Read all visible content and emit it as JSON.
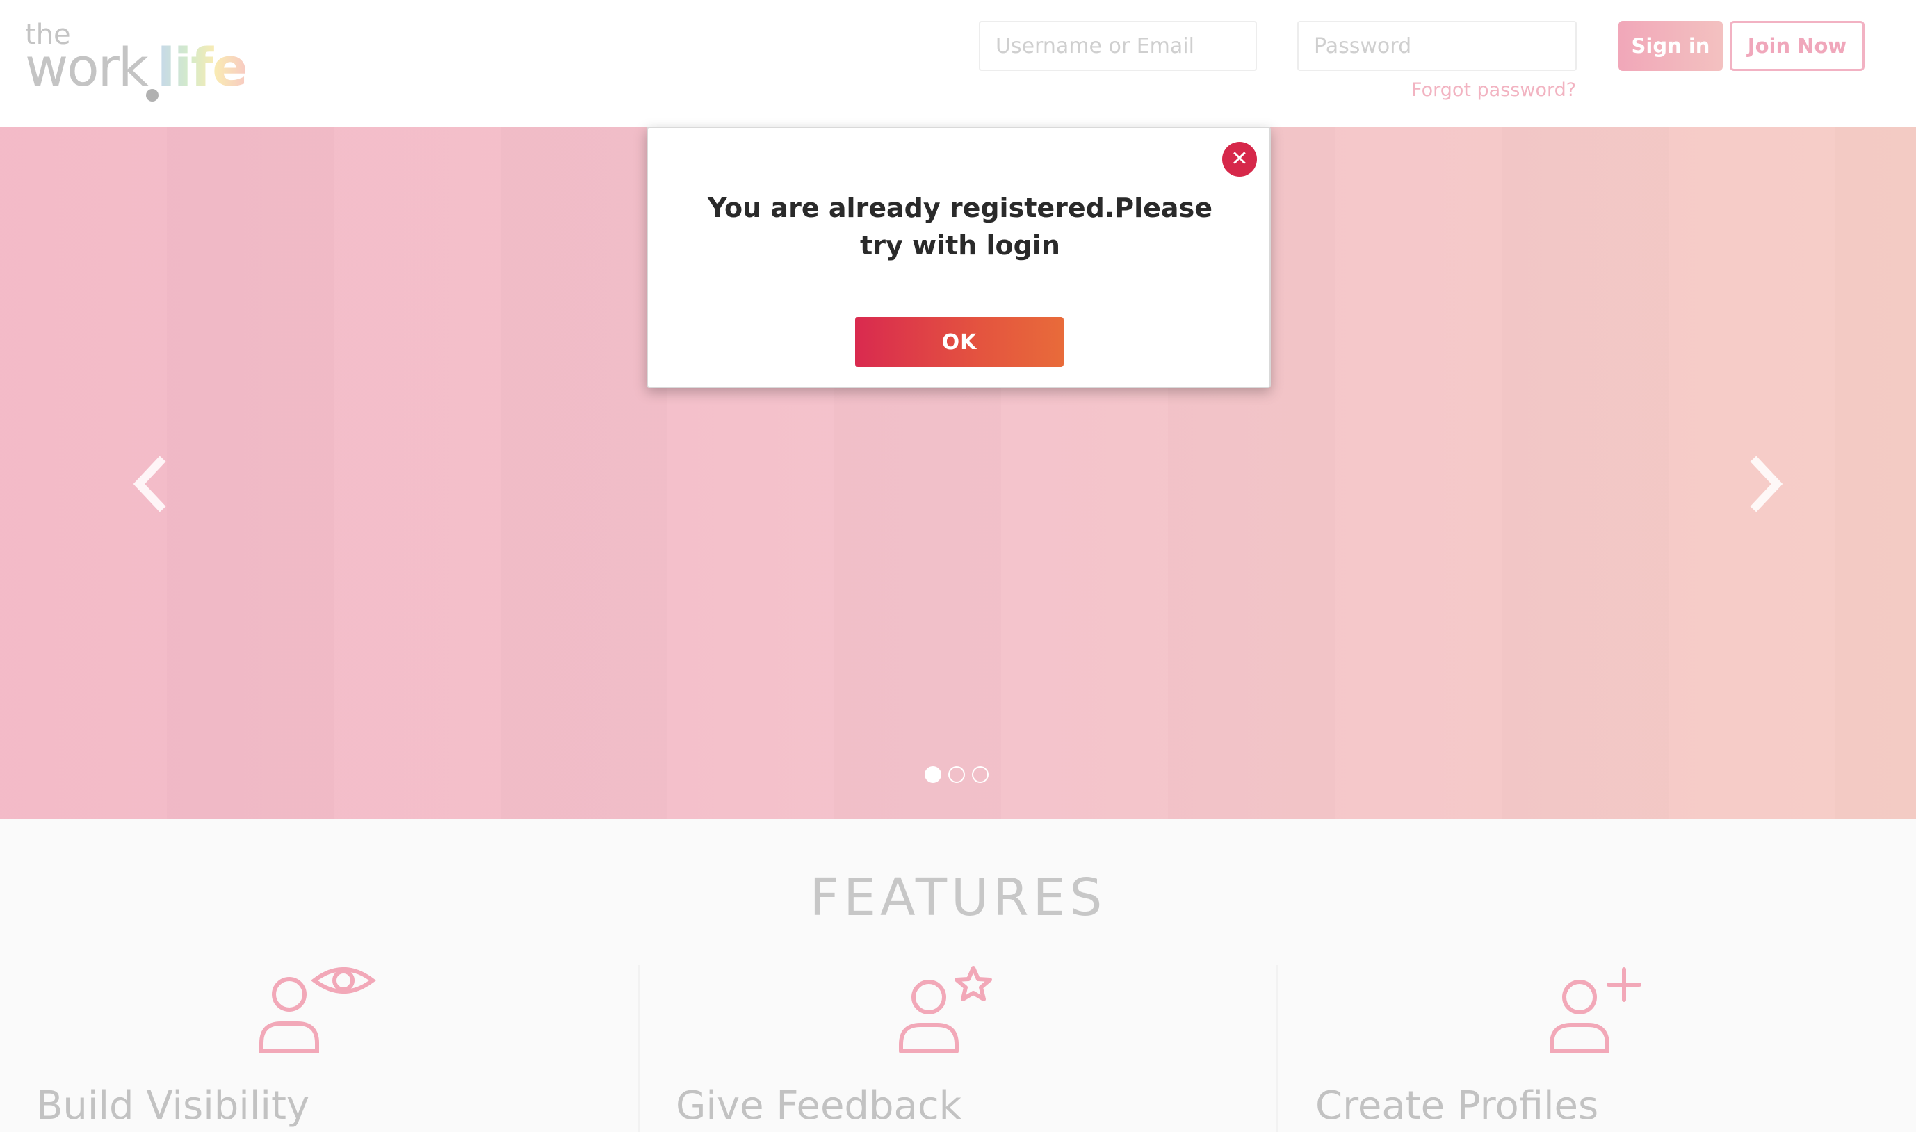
{
  "header": {
    "logo": {
      "the": "the",
      "work": "work",
      "life": "life"
    },
    "username_placeholder": "Username or Email",
    "password_placeholder": "Password",
    "forgot_password": "Forgot password?",
    "sign_in": "Sign in",
    "join_now": "Join Now"
  },
  "carousel": {
    "slide_count": 3,
    "active_index": 0
  },
  "features": {
    "title": "FEATURES",
    "items": [
      {
        "title": "Build Visibility",
        "icon": "user-eye-icon"
      },
      {
        "title": "Give Feedback",
        "icon": "user-star-icon"
      },
      {
        "title": "Create Profiles",
        "icon": "user-plus-icon"
      }
    ]
  },
  "modal": {
    "message": "You are already registered.Please try with login",
    "ok": "OK",
    "close_icon": "close-icon"
  },
  "colors": {
    "accent_red": "#d6284a",
    "accent_orange": "#e86b3a",
    "pink": "#f2b3c1",
    "hero_left": "#f3b9c7",
    "hero_right": "#f6cdc6"
  }
}
